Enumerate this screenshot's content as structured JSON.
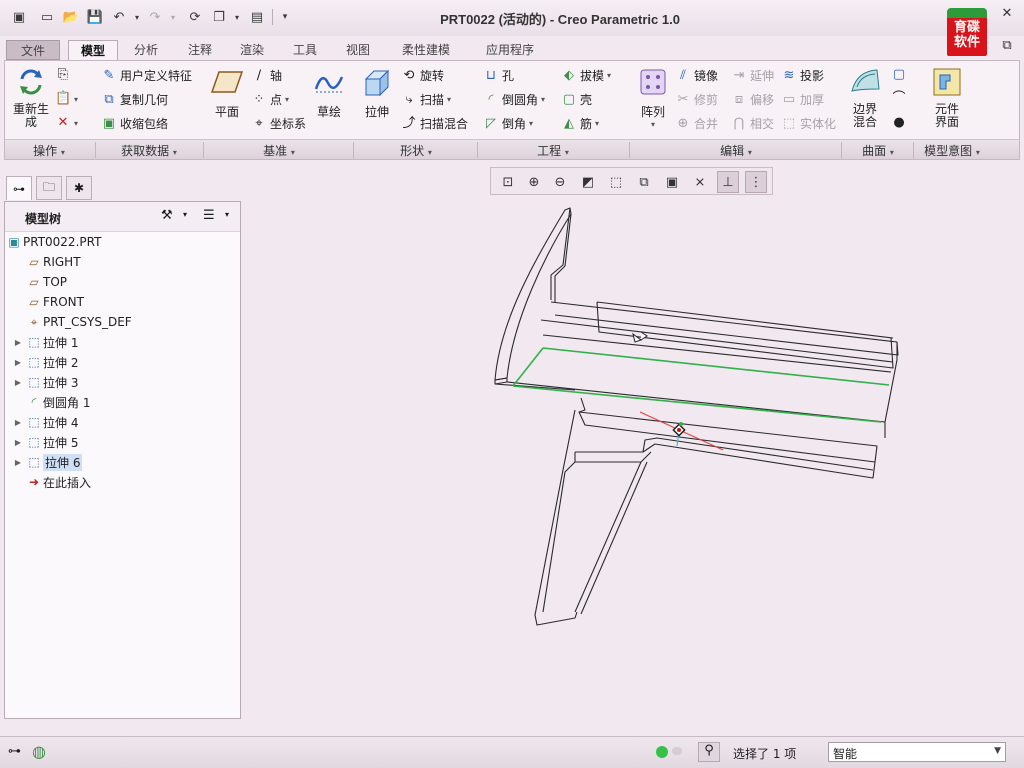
{
  "window": {
    "title": "PRT0022 (活动的) - Creo Parametric 1.0",
    "logo_text": "育碟\n软件"
  },
  "quick_access": [
    "new-icon",
    "open-icon",
    "save-icon",
    "undo-icon",
    "redo-icon",
    "regenerate-icon",
    "windows-icon",
    "close-window-icon"
  ],
  "ribbon_tabs": [
    {
      "label": "文件"
    },
    {
      "label": "模型"
    },
    {
      "label": "分析"
    },
    {
      "label": "注释"
    },
    {
      "label": "渲染"
    },
    {
      "label": "工具"
    },
    {
      "label": "视图"
    },
    {
      "label": "柔性建模"
    },
    {
      "label": "应用程序"
    }
  ],
  "ribbon": {
    "regenerate": "重新生成",
    "udf": "用户定义特征",
    "copy_geom": "复制几何",
    "shrinkwrap": "收缩包络",
    "plane": "平面",
    "axis": "轴",
    "point": "点",
    "csys": "坐标系",
    "sketch": "草绘",
    "extrude": "拉伸",
    "revolve": "旋转",
    "sweep": "扫描",
    "swept_blend": "扫描混合",
    "hole": "孔",
    "round": "倒圆角",
    "chamfer": "倒角",
    "draft": "拔模",
    "shell": "壳",
    "rib": "筋",
    "pattern": "阵列",
    "mirror": "镜像",
    "trim": "修剪",
    "merge": "合并",
    "extend": "延伸",
    "offset": "偏移",
    "intersect": "相交",
    "project": "投影",
    "thicken": "加厚",
    "solidify": "实体化",
    "boundary_blend": "边界混合",
    "component_interface": "元件界面",
    "groups": {
      "operations": "操作",
      "get_data": "获取数据",
      "datum": "基准",
      "shapes": "形状",
      "engineering": "工程",
      "editing": "编辑",
      "surfaces": "曲面",
      "model_intent": "模型意图"
    }
  },
  "model_tree": {
    "title": "模型树",
    "items": [
      {
        "label": "PRT0022.PRT",
        "icon": "part-icon"
      },
      {
        "label": "RIGHT",
        "icon": "datum-plane-icon"
      },
      {
        "label": "TOP",
        "icon": "datum-plane-icon"
      },
      {
        "label": "FRONT",
        "icon": "datum-plane-icon"
      },
      {
        "label": "PRT_CSYS_DEF",
        "icon": "csys-icon"
      },
      {
        "label": "拉伸 1",
        "icon": "extrude-icon"
      },
      {
        "label": "拉伸 2",
        "icon": "extrude-icon"
      },
      {
        "label": "拉伸 3",
        "icon": "extrude-icon"
      },
      {
        "label": "倒圆角 1",
        "icon": "round-icon"
      },
      {
        "label": "拉伸 4",
        "icon": "extrude-icon"
      },
      {
        "label": "拉伸 5",
        "icon": "extrude-icon"
      },
      {
        "label": "拉伸 6",
        "icon": "extrude-icon"
      },
      {
        "label": "在此插入",
        "icon": "insert-arrow-icon"
      }
    ]
  },
  "status": {
    "message": "选择了 1 项",
    "filter_value": "智能"
  },
  "colors": {
    "background": "#f1e8f0",
    "highlight": "#2fb14b",
    "selection": "#cfe0f6"
  }
}
